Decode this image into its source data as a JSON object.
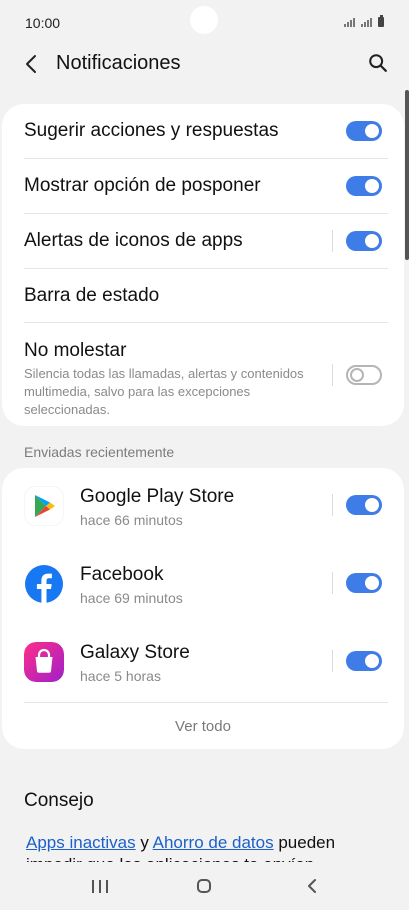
{
  "status": {
    "time": "10:00"
  },
  "header": {
    "title": "Notificaciones"
  },
  "settings": [
    {
      "label": "Sugerir acciones y respuestas",
      "on": true
    },
    {
      "label": "Mostrar opción de posponer",
      "on": true
    },
    {
      "label": "Alertas de iconos de apps",
      "on": true
    },
    {
      "label": "Barra de estado"
    },
    {
      "label": "No molestar",
      "description": "Silencia todas las llamadas, alertas y contenidos multimedia, salvo para las excepciones seleccionadas.",
      "on": false
    }
  ],
  "recent": {
    "title": "Enviadas recientemente",
    "apps": [
      {
        "name": "Google Play Store",
        "time": "hace 66 minutos",
        "on": true,
        "icon": "google-play-icon"
      },
      {
        "name": "Facebook",
        "time": "hace 69 minutos",
        "on": true,
        "icon": "facebook-icon"
      },
      {
        "name": "Galaxy Store",
        "time": "hace 5 horas",
        "on": true,
        "icon": "galaxy-store-icon"
      }
    ],
    "see_all": "Ver todo"
  },
  "tip": {
    "title": "Consejo",
    "link1": "Apps inactivas",
    "connector": " y ",
    "link2": "Ahorro de datos",
    "rest": " pueden impedir que las aplicaciones te envíen"
  },
  "colors": {
    "accent": "#3e7ce8",
    "link": "#1b61c9"
  }
}
